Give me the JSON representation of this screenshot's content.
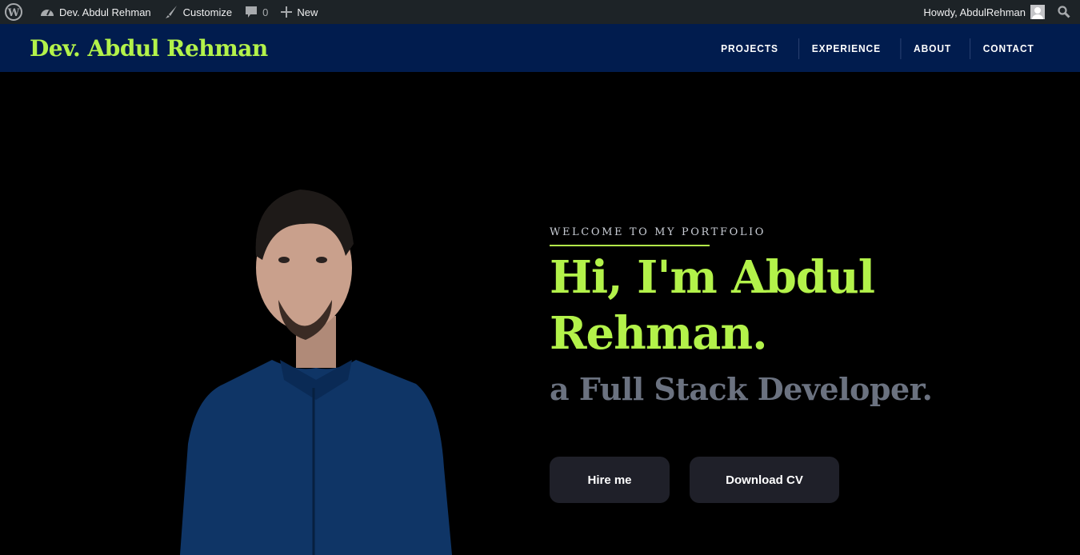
{
  "admin_bar": {
    "site_name": "Dev. Abdul Rehman",
    "customize": "Customize",
    "comments_count": "0",
    "new": "New",
    "howdy": "Howdy, AbdulRehman"
  },
  "header": {
    "site_title": "Dev. Abdul Rehman",
    "nav": [
      "PROJECTS",
      "EXPERIENCE",
      "ABOUT",
      "CONTACT"
    ]
  },
  "hero": {
    "eyebrow": "WELCOME TO MY PORTFOLIO",
    "heading": "Hi, I'm Abdul Rehman.",
    "subheading": "a Full Stack Developer.",
    "buttons": [
      "Hire me",
      "Download CV"
    ]
  },
  "colors": {
    "accent": "#b3f24a",
    "header_bg": "#011c4e",
    "admin_bg": "#1d2327",
    "button_bg": "#1f2029",
    "subtitle": "#6b7280"
  }
}
